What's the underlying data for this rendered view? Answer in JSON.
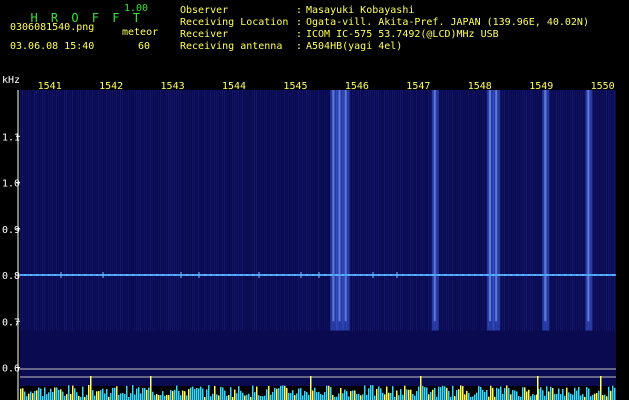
{
  "app": {
    "name": "H R O F F T",
    "version": "1.00"
  },
  "file": {
    "name": "0306081540.png",
    "datetime": "03.06.08 15:40"
  },
  "meteor": {
    "label": "meteor",
    "count": "60"
  },
  "info": [
    {
      "key": "Observer",
      "sep": ":",
      "value": "Masayuki Kobayashi"
    },
    {
      "key": "Receiving Location",
      "sep": ":",
      "value": "Ogata-vill. Akita-Pref. JAPAN (139.96E, 40.02N)"
    },
    {
      "key": "Receiver",
      "sep": ":",
      "value": "ICOM IC-575 53.7492(@LCD)MHz USB"
    },
    {
      "key": "Receiving antenna",
      "sep": ":",
      "value": "A504HB(yagi 4el)"
    }
  ],
  "colors": {
    "bg": "#000000",
    "spectrum": "#0a0a50",
    "signal": "#4aa0ff",
    "header": "#35e235",
    "ticks": "#ffff5a",
    "axis": "#ffffff"
  },
  "chart_data": {
    "type": "heatmap",
    "x_label": "",
    "y_unit": "kHz",
    "x_ticks": [
      "1541",
      "1542",
      "1543",
      "1544",
      "1545",
      "1546",
      "1547",
      "1548",
      "1549",
      "1550"
    ],
    "y_ticks": [
      "1.1",
      "1.0",
      "0.9",
      "0.8",
      "0.7",
      "0.6"
    ],
    "x_range": [
      1540.55,
      1550.25
    ],
    "y_range": [
      0.56,
      1.2
    ],
    "carrier_khz": 0.8,
    "bright_columns": [
      1545.65,
      1545.75,
      1545.85,
      1547.3,
      1548.2,
      1548.3,
      1549.1,
      1549.8
    ]
  }
}
